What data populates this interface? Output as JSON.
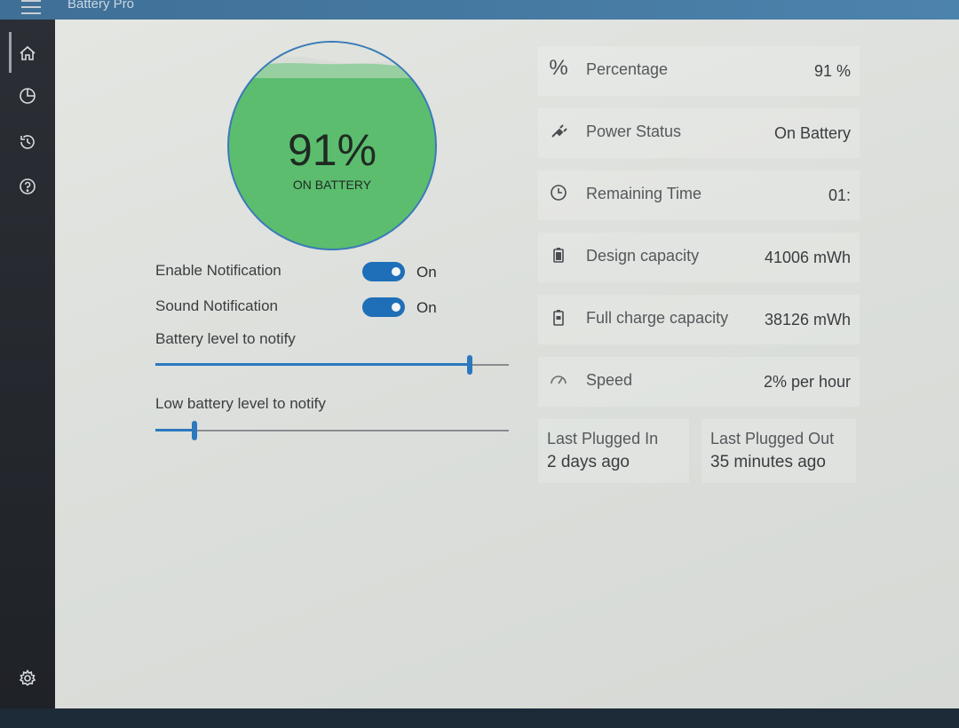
{
  "app": {
    "title": "Battery Pro"
  },
  "nav": {
    "items": [
      {
        "icon": "home-icon"
      },
      {
        "icon": "pie-chart-icon"
      },
      {
        "icon": "history-icon"
      },
      {
        "icon": "help-icon"
      }
    ],
    "settings_icon": "gear-icon"
  },
  "gauge": {
    "level": 0.91,
    "percent_text": "91%",
    "status_text": "ON BATTERY",
    "fill_color": "#5cbd6f"
  },
  "settings": {
    "enable_notification": {
      "label": "Enable Notification",
      "state": "On"
    },
    "sound_notification": {
      "label": "Sound Notification",
      "state": "On"
    },
    "battery_level": {
      "label": "Battery level to notify",
      "value_fraction": 0.89
    },
    "low_battery_level": {
      "label": "Low battery level to notify",
      "value_fraction": 0.11
    }
  },
  "info": [
    {
      "icon": "percent-icon",
      "name": "Percentage",
      "value": "91 %"
    },
    {
      "icon": "plug-icon",
      "name": "Power Status",
      "value": "On Battery"
    },
    {
      "icon": "clock-icon",
      "name": "Remaining Time",
      "value": "01:"
    },
    {
      "icon": "battery-icon",
      "name": "Design capacity",
      "value": "41006 mWh"
    },
    {
      "icon": "battery-full-icon",
      "name": "Full charge capacity",
      "value": "38126 mWh"
    },
    {
      "icon": "speedometer-icon",
      "name": "Speed",
      "value": "2% per hour"
    }
  ],
  "plugged": {
    "in": {
      "caption": "Last Plugged In",
      "value": "2 days ago"
    },
    "out": {
      "caption": "Last Plugged Out",
      "value": "35 minutes ago"
    }
  },
  "colors": {
    "accent": "#1e6fb8",
    "gauge_green": "#5cbd6f"
  }
}
